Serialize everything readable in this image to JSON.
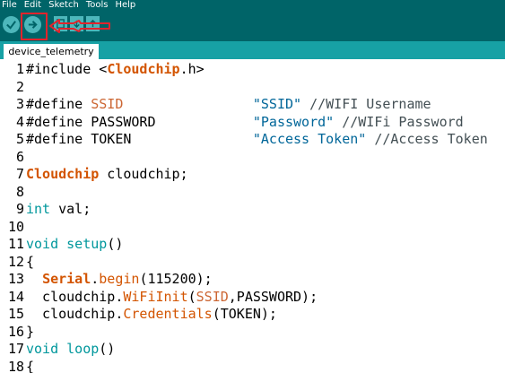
{
  "menu": [
    "File",
    "Edit",
    "Sketch",
    "Tools",
    "Help"
  ],
  "toolbar": {
    "buttons": [
      {
        "name": "verify",
        "icon": "checkmark-icon"
      },
      {
        "name": "upload",
        "icon": "arrow-right-icon"
      },
      {
        "name": "new",
        "icon": "new-file-icon"
      },
      {
        "name": "open",
        "icon": "open-icon"
      },
      {
        "name": "save",
        "icon": "save-icon"
      }
    ],
    "highlight_color": "#e2242c"
  },
  "tab": {
    "label": "device_telemetry"
  },
  "code": [
    {
      "n": "1",
      "parts": [
        {
          "t": "#include <",
          "c": ""
        },
        {
          "t": "Cloudchip",
          "c": "cls"
        },
        {
          "t": ".h>",
          "c": ""
        }
      ]
    },
    {
      "n": "2",
      "parts": []
    },
    {
      "n": "3",
      "parts": [
        {
          "t": "#define ",
          "c": ""
        },
        {
          "t": "SSID",
          "c": "kw2"
        },
        {
          "t": "                ",
          "c": ""
        },
        {
          "t": "\"SSID\"",
          "c": "str"
        },
        {
          "t": " //WIFI Username",
          "c": "cmt"
        }
      ]
    },
    {
      "n": "4",
      "parts": [
        {
          "t": "#define PASSWORD            ",
          "c": ""
        },
        {
          "t": "\"Password\"",
          "c": "str"
        },
        {
          "t": " //WIFi Password",
          "c": "cmt"
        }
      ]
    },
    {
      "n": "5",
      "parts": [
        {
          "t": "#define TOKEN               ",
          "c": ""
        },
        {
          "t": "\"Access Token\"",
          "c": "str"
        },
        {
          "t": " //Access Token",
          "c": "cmt"
        }
      ]
    },
    {
      "n": "6",
      "parts": []
    },
    {
      "n": "7",
      "parts": [
        {
          "t": "Cloudchip",
          "c": "cls"
        },
        {
          "t": " cloudchip;",
          "c": ""
        }
      ]
    },
    {
      "n": "8",
      "parts": []
    },
    {
      "n": "9",
      "parts": [
        {
          "t": "int",
          "c": "kw"
        },
        {
          "t": " val;",
          "c": ""
        }
      ]
    },
    {
      "n": "10",
      "parts": []
    },
    {
      "n": "11",
      "parts": [
        {
          "t": "void",
          "c": "kw"
        },
        {
          "t": " ",
          "c": ""
        },
        {
          "t": "setup",
          "c": "kw"
        },
        {
          "t": "()",
          "c": ""
        }
      ]
    },
    {
      "n": "12",
      "parts": [
        {
          "t": "{",
          "c": ""
        }
      ]
    },
    {
      "n": "13",
      "parts": [
        {
          "t": "  ",
          "c": ""
        },
        {
          "t": "Serial",
          "c": "cls"
        },
        {
          "t": ".",
          "c": ""
        },
        {
          "t": "begin",
          "c": "fn"
        },
        {
          "t": "(115200);",
          "c": ""
        }
      ]
    },
    {
      "n": "14",
      "parts": [
        {
          "t": "  cloudchip.",
          "c": ""
        },
        {
          "t": "WiFiInit",
          "c": "fn"
        },
        {
          "t": "(",
          "c": ""
        },
        {
          "t": "SSID",
          "c": "kw2"
        },
        {
          "t": ",PASSWORD);",
          "c": ""
        }
      ]
    },
    {
      "n": "15",
      "parts": [
        {
          "t": "  cloudchip.",
          "c": ""
        },
        {
          "t": "Credentials",
          "c": "fn"
        },
        {
          "t": "(TOKEN);",
          "c": ""
        }
      ]
    },
    {
      "n": "16",
      "parts": [
        {
          "t": "}",
          "c": ""
        }
      ]
    },
    {
      "n": "17",
      "parts": [
        {
          "t": "void",
          "c": "kw"
        },
        {
          "t": " ",
          "c": ""
        },
        {
          "t": "loop",
          "c": "kw"
        },
        {
          "t": "()",
          "c": ""
        }
      ]
    },
    {
      "n": "18",
      "parts": [
        {
          "t": "{",
          "c": ""
        }
      ]
    }
  ]
}
